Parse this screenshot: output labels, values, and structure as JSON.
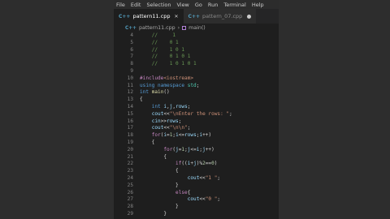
{
  "menu": [
    "File",
    "Edit",
    "Selection",
    "View",
    "Go",
    "Run",
    "Terminal",
    "Help"
  ],
  "tabs": [
    {
      "icon": "C++",
      "label": "pattern11.cpp",
      "active": true,
      "indicator": "close",
      "glyph": "✕"
    },
    {
      "icon": "C++",
      "label": "pattern_07.cpp",
      "active": false,
      "indicator": "dot"
    }
  ],
  "breadcrumb": {
    "icon": "C++",
    "file": "pattern11.cpp",
    "separator": "›",
    "symbol": "main()"
  },
  "editor": {
    "lines": [
      {
        "num": "4",
        "tokens": [
          {
            "t": "    ",
            "c": "plain"
          },
          {
            "t": "//     1",
            "c": "comment"
          }
        ]
      },
      {
        "num": "5",
        "tokens": [
          {
            "t": "    ",
            "c": "plain"
          },
          {
            "t": "//    0 1",
            "c": "comment"
          }
        ]
      },
      {
        "num": "6",
        "tokens": [
          {
            "t": "    ",
            "c": "plain"
          },
          {
            "t": "//    1 0 1",
            "c": "comment"
          }
        ]
      },
      {
        "num": "7",
        "tokens": [
          {
            "t": "    ",
            "c": "plain"
          },
          {
            "t": "//    0 1 0 1",
            "c": "comment"
          }
        ]
      },
      {
        "num": "8",
        "tokens": [
          {
            "t": "    ",
            "c": "plain"
          },
          {
            "t": "//    1 0 1 0 1",
            "c": "comment"
          }
        ]
      },
      {
        "num": "9",
        "tokens": []
      },
      {
        "num": "10",
        "tokens": [
          {
            "t": "#include",
            "c": "control"
          },
          {
            "t": "<iostream>",
            "c": "string"
          }
        ]
      },
      {
        "num": "11",
        "tokens": [
          {
            "t": "using",
            "c": "keyword"
          },
          {
            "t": " ",
            "c": "plain"
          },
          {
            "t": "namespace",
            "c": "keyword"
          },
          {
            "t": " ",
            "c": "plain"
          },
          {
            "t": "std",
            "c": "type"
          },
          {
            "t": ";",
            "c": "plain"
          }
        ]
      },
      {
        "num": "12",
        "tokens": [
          {
            "t": "int",
            "c": "keyword"
          },
          {
            "t": " ",
            "c": "plain"
          },
          {
            "t": "main",
            "c": "func"
          },
          {
            "t": "()",
            "c": "plain"
          }
        ]
      },
      {
        "num": "13",
        "tokens": [
          {
            "t": "{",
            "c": "plain"
          }
        ]
      },
      {
        "num": "14",
        "tokens": [
          {
            "t": "    ",
            "c": "plain"
          },
          {
            "t": "int",
            "c": "keyword"
          },
          {
            "t": " ",
            "c": "plain"
          },
          {
            "t": "i",
            "c": "var"
          },
          {
            "t": ",",
            "c": "plain"
          },
          {
            "t": "j",
            "c": "var"
          },
          {
            "t": ",",
            "c": "plain"
          },
          {
            "t": "rows",
            "c": "var"
          },
          {
            "t": ";",
            "c": "plain"
          }
        ]
      },
      {
        "num": "15",
        "tokens": [
          {
            "t": "    ",
            "c": "plain"
          },
          {
            "t": "cout",
            "c": "var"
          },
          {
            "t": "<<",
            "c": "plain"
          },
          {
            "t": "\"\\nEnter the rows: \"",
            "c": "string"
          },
          {
            "t": ";",
            "c": "plain"
          }
        ]
      },
      {
        "num": "16",
        "tokens": [
          {
            "t": "    ",
            "c": "plain"
          },
          {
            "t": "cin",
            "c": "var"
          },
          {
            "t": ">>",
            "c": "plain"
          },
          {
            "t": "rows",
            "c": "var"
          },
          {
            "t": ";",
            "c": "plain"
          }
        ]
      },
      {
        "num": "17",
        "tokens": [
          {
            "t": "    ",
            "c": "plain"
          },
          {
            "t": "cout",
            "c": "var"
          },
          {
            "t": "<<",
            "c": "plain"
          },
          {
            "t": "\"\\n\\n\"",
            "c": "string"
          },
          {
            "t": ";",
            "c": "plain"
          }
        ]
      },
      {
        "num": "18",
        "tokens": [
          {
            "t": "    ",
            "c": "plain"
          },
          {
            "t": "for",
            "c": "control"
          },
          {
            "t": "(",
            "c": "plain"
          },
          {
            "t": "i",
            "c": "var"
          },
          {
            "t": "=",
            "c": "plain"
          },
          {
            "t": "1",
            "c": "number"
          },
          {
            "t": ";",
            "c": "plain"
          },
          {
            "t": "i",
            "c": "var"
          },
          {
            "t": "<=",
            "c": "plain"
          },
          {
            "t": "rows",
            "c": "var"
          },
          {
            "t": ";",
            "c": "plain"
          },
          {
            "t": "i",
            "c": "var"
          },
          {
            "t": "++)",
            "c": "plain"
          }
        ]
      },
      {
        "num": "19",
        "tokens": [
          {
            "t": "    {",
            "c": "plain"
          }
        ]
      },
      {
        "num": "20",
        "tokens": [
          {
            "t": "        ",
            "c": "plain"
          },
          {
            "t": "for",
            "c": "control"
          },
          {
            "t": "(",
            "c": "plain"
          },
          {
            "t": "j",
            "c": "var"
          },
          {
            "t": "=",
            "c": "plain"
          },
          {
            "t": "1",
            "c": "number"
          },
          {
            "t": ";",
            "c": "plain"
          },
          {
            "t": "j",
            "c": "var"
          },
          {
            "t": "<=",
            "c": "plain"
          },
          {
            "t": "i",
            "c": "var"
          },
          {
            "t": ";",
            "c": "plain"
          },
          {
            "t": "j",
            "c": "var"
          },
          {
            "t": "++)",
            "c": "plain"
          }
        ]
      },
      {
        "num": "21",
        "tokens": [
          {
            "t": "        {",
            "c": "plain"
          }
        ]
      },
      {
        "num": "22",
        "tokens": [
          {
            "t": "            ",
            "c": "plain"
          },
          {
            "t": "if",
            "c": "control"
          },
          {
            "t": "((",
            "c": "plain"
          },
          {
            "t": "i",
            "c": "var"
          },
          {
            "t": "+",
            "c": "plain"
          },
          {
            "t": "j",
            "c": "var"
          },
          {
            "t": ")%",
            "c": "plain"
          },
          {
            "t": "2",
            "c": "number"
          },
          {
            "t": "==",
            "c": "plain"
          },
          {
            "t": "0",
            "c": "number"
          },
          {
            "t": ")",
            "c": "plain"
          }
        ]
      },
      {
        "num": "23",
        "tokens": [
          {
            "t": "            {",
            "c": "plain"
          }
        ]
      },
      {
        "num": "24",
        "tokens": [
          {
            "t": "                ",
            "c": "plain"
          },
          {
            "t": "cout",
            "c": "var"
          },
          {
            "t": "<<",
            "c": "plain"
          },
          {
            "t": "\"1 \"",
            "c": "string"
          },
          {
            "t": ";",
            "c": "plain"
          }
        ]
      },
      {
        "num": "25",
        "tokens": [
          {
            "t": "            }",
            "c": "plain"
          }
        ]
      },
      {
        "num": "26",
        "tokens": [
          {
            "t": "            ",
            "c": "plain"
          },
          {
            "t": "else",
            "c": "control"
          },
          {
            "t": "{",
            "c": "plain"
          }
        ]
      },
      {
        "num": "27",
        "tokens": [
          {
            "t": "                ",
            "c": "plain"
          },
          {
            "t": "cout",
            "c": "var"
          },
          {
            "t": "<<",
            "c": "plain"
          },
          {
            "t": "\"0 \"",
            "c": "string"
          },
          {
            "t": ";",
            "c": "plain"
          }
        ]
      },
      {
        "num": "28",
        "tokens": [
          {
            "t": "            }",
            "c": "plain"
          }
        ]
      },
      {
        "num": "29",
        "tokens": [
          {
            "t": "        }",
            "c": "plain"
          }
        ]
      }
    ]
  }
}
